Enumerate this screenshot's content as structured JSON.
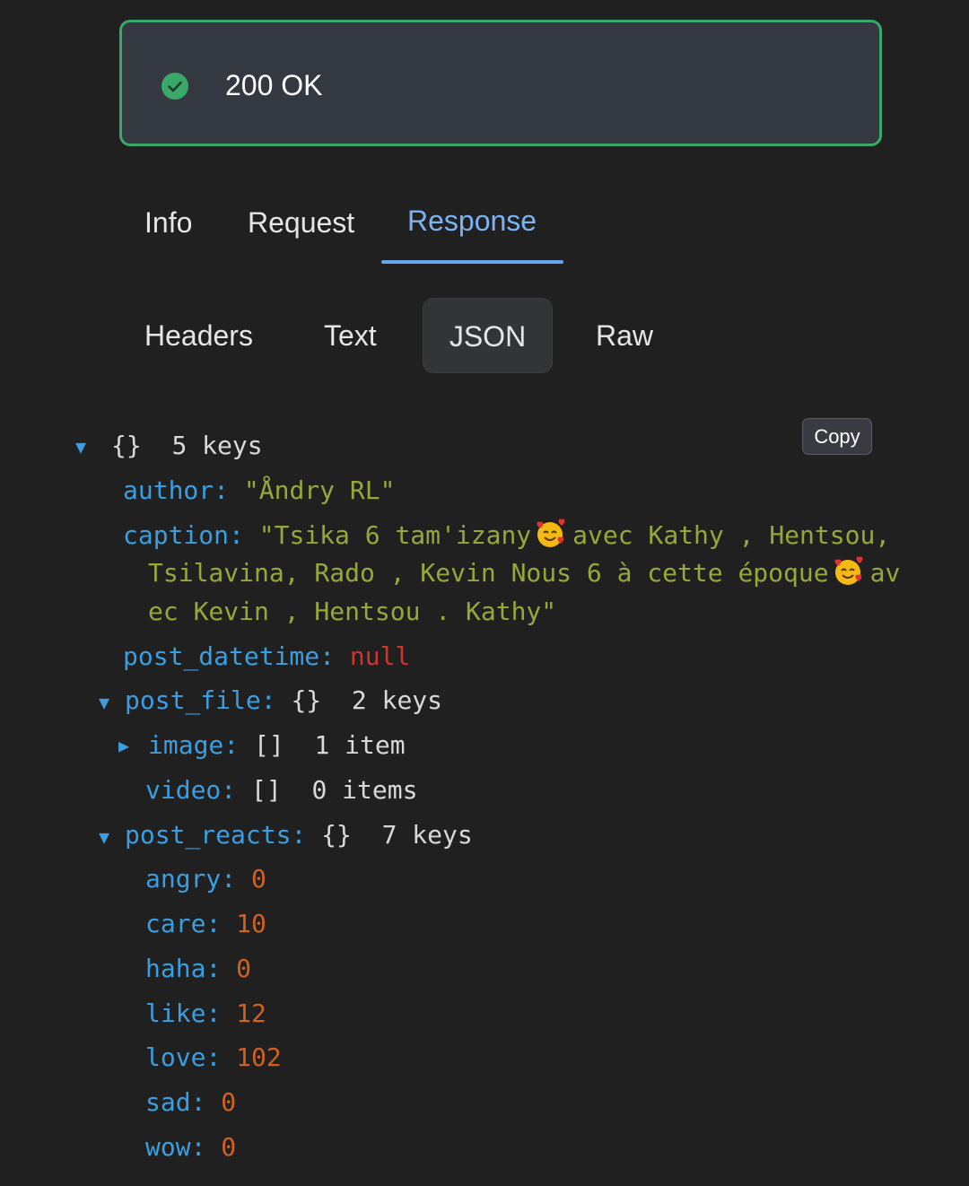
{
  "status": {
    "text": "200 OK",
    "icon": "check-circle-icon",
    "color": "#3aa868"
  },
  "tabs": [
    {
      "label": "Info"
    },
    {
      "label": "Request"
    },
    {
      "label": "Response",
      "active": true
    }
  ],
  "subtabs": [
    {
      "label": "Headers"
    },
    {
      "label": "Text"
    },
    {
      "label": "JSON",
      "active": true
    },
    {
      "label": "Raw"
    }
  ],
  "copy_label": "Copy",
  "json": {
    "root_brace": "{}",
    "root_count": "5 keys",
    "author_key": "author",
    "author_value": "\"Åndry RL\"",
    "caption_key": "caption",
    "caption_part1": "\"Tsika 6 tam'izany",
    "caption_part2": "avec Kathy , Hentsou,",
    "caption_part3": "Tsilavina, Rado , Kevin Nous 6 à cette époque",
    "caption_part4": "av",
    "caption_part5": "ec Kevin , Hentsou . Kathy\"",
    "post_datetime_key": "post_datetime",
    "post_datetime_value": "null",
    "post_file_key": "post_file",
    "post_file_brace": "{}",
    "post_file_count": "2 keys",
    "image_key": "image",
    "image_brace": "[]",
    "image_count": "1 item",
    "video_key": "video",
    "video_brace": "[]",
    "video_count": "0 items",
    "post_reacts_key": "post_reacts",
    "post_reacts_brace": "{}",
    "post_reacts_count": "7 keys",
    "reacts": [
      {
        "key": "angry",
        "value": "0"
      },
      {
        "key": "care",
        "value": "10"
      },
      {
        "key": "haha",
        "value": "0"
      },
      {
        "key": "like",
        "value": "12"
      },
      {
        "key": "love",
        "value": "102"
      },
      {
        "key": "sad",
        "value": "0"
      },
      {
        "key": "wow",
        "value": "0"
      }
    ]
  }
}
